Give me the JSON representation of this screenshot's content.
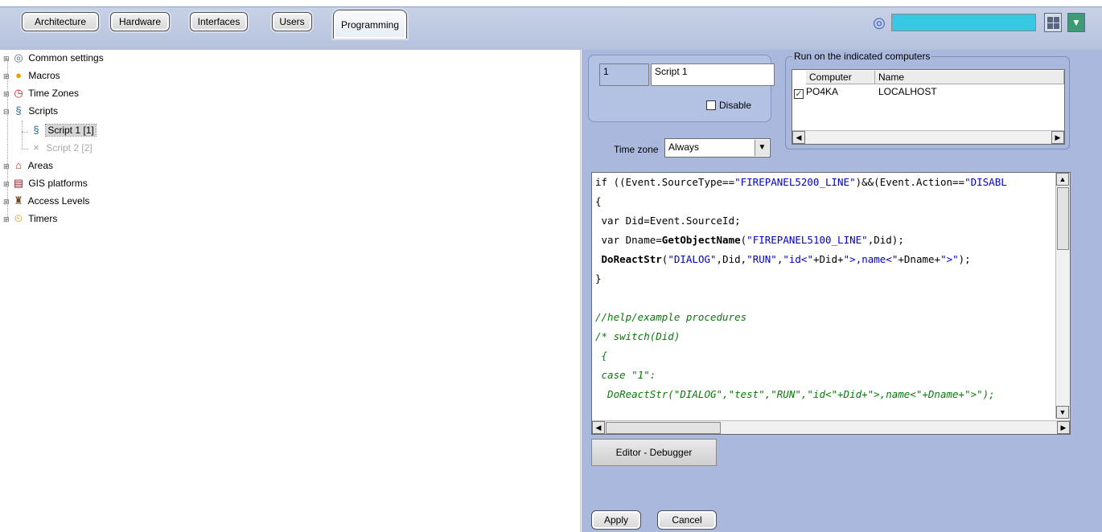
{
  "tabs": [
    {
      "label": "Architecture"
    },
    {
      "label": "Hardware"
    },
    {
      "label": "Interfaces"
    },
    {
      "label": "Users"
    },
    {
      "label": "Programming",
      "active": true
    }
  ],
  "tree": {
    "items": [
      {
        "label": "Common settings",
        "icon": "gear-icon"
      },
      {
        "label": "Macros",
        "icon": "macro-icon"
      },
      {
        "label": "Time Zones",
        "icon": "clock-icon"
      },
      {
        "label": "Scripts",
        "icon": "script-icon"
      },
      {
        "label": "Script 1 [1]",
        "icon": "script-icon"
      },
      {
        "label": "Script 2 [2]",
        "icon": "disabled-x-icon"
      },
      {
        "label": "Areas",
        "icon": "house-icon"
      },
      {
        "label": "GIS platforms",
        "icon": "map-icon"
      },
      {
        "label": "Access Levels",
        "icon": "access-levels-icon"
      },
      {
        "label": "Timers",
        "icon": "alarm-clock-icon"
      }
    ]
  },
  "script": {
    "id": "1",
    "name": "Script 1",
    "disable_label": "Disable",
    "disable_checked": false
  },
  "run_on": {
    "title": "Run on the indicated computers",
    "columns": [
      "Computer",
      "Name"
    ],
    "rows": [
      {
        "computer": "PO4KA",
        "name": "LOCALHOST",
        "checked": true
      }
    ]
  },
  "time_zone": {
    "label": "Time zone",
    "value": "Always"
  },
  "code": {
    "lines": [
      "if ((Event.SourceType==\"FIREPANEL5200_LINE\")&&(Event.Action==\"DISABL",
      "{",
      " var Did=Event.SourceId;",
      " var Dname=GetObjectName(\"FIREPANEL5100_LINE\",Did);",
      " DoReactStr(\"DIALOG\",Did,\"RUN\",\"id<\"+Did+\">,name<\"+Dname+\">\");",
      "}",
      "",
      "//help/example procedures",
      "/* switch(Did)",
      " {",
      " case \"1\":",
      "  DoReactStr(\"DIALOG\",\"test\",\"RUN\",\"id<\"+Did+\">,name<\"+Dname+\">\");"
    ]
  },
  "buttons": {
    "editor_debugger": "Editor - Debugger",
    "apply": "Apply",
    "cancel": "Cancel"
  },
  "colors": {
    "panel_bg": "#a9b8dc",
    "tree_bg": "#ffffff",
    "top_field": "#37c8e6",
    "string_literal": "#0000cc",
    "comment": "#0a7a0a"
  }
}
